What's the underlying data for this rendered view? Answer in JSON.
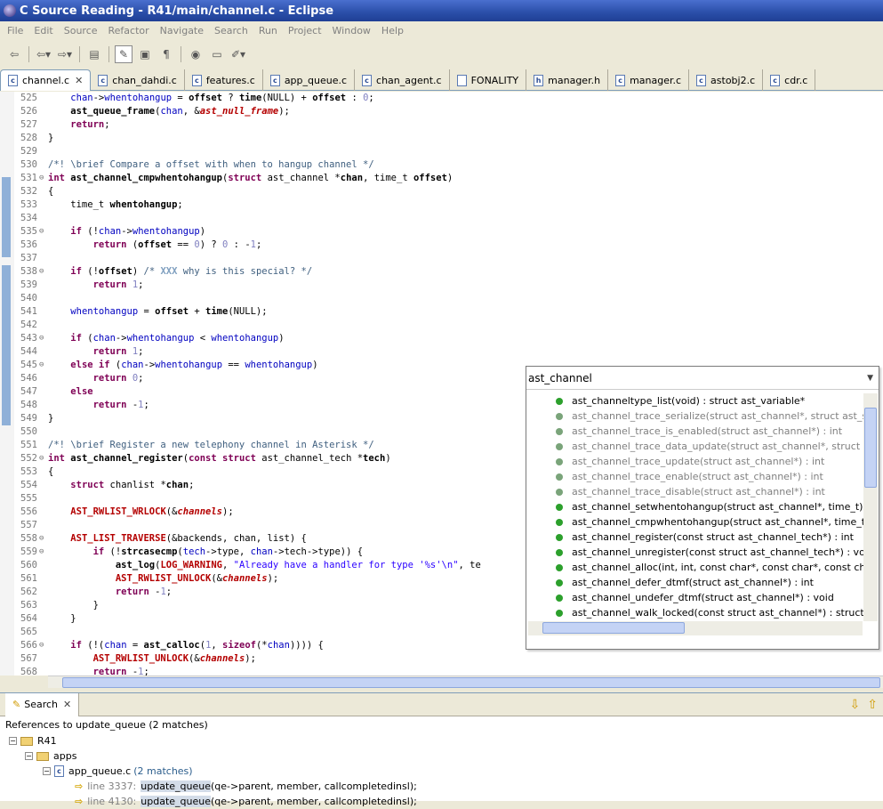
{
  "window": {
    "title": "C Source Reading - R41/main/channel.c - Eclipse"
  },
  "menu": [
    "File",
    "Edit",
    "Source",
    "Refactor",
    "Navigate",
    "Search",
    "Run",
    "Project",
    "Window",
    "Help"
  ],
  "tabs": [
    {
      "label": "channel.c",
      "active": true
    },
    {
      "label": "chan_dahdi.c"
    },
    {
      "label": "features.c"
    },
    {
      "label": "app_queue.c"
    },
    {
      "label": "chan_agent.c"
    },
    {
      "label": "FONALITY"
    },
    {
      "label": "manager.h"
    },
    {
      "label": "manager.c"
    },
    {
      "label": "astobj2.c"
    },
    {
      "label": "cdr.c"
    }
  ],
  "code": [
    {
      "n": "525",
      "f": "",
      "h": "    <span class='fld'>chan</span>-><span class='fld'>whentohangup</span> = <span class='fn'>offset</span> ? <span class='fn'>time</span>(NULL) + <span class='fn'>offset</span> : <span class='num'>0</span>;"
    },
    {
      "n": "526",
      "f": "",
      "h": "    <span class='fn'>ast_queue_frame</span>(<span class='fld'>chan</span>, &amp;<span class='mac'>ast_null_frame</span>);"
    },
    {
      "n": "527",
      "f": "",
      "h": "    <span class='kw'>return</span>;"
    },
    {
      "n": "528",
      "f": "",
      "h": "}"
    },
    {
      "n": "529",
      "f": "",
      "h": ""
    },
    {
      "n": "530",
      "f": "",
      "h": "<span class='cm'>/*! \\brief Compare a offset with when to hangup channel */</span>"
    },
    {
      "n": "531",
      "f": "⊖",
      "h": "<span class='kw'>int</span> <span class='fn'>ast_channel_cmpwhentohangup</span>(<span class='kw'>struct</span> ast_channel *<span class='fn'>chan</span>, time_t <span class='fn'>offset</span>)"
    },
    {
      "n": "532",
      "f": "",
      "h": "{"
    },
    {
      "n": "533",
      "f": "",
      "h": "    time_t <span class='fn'>whentohangup</span>;"
    },
    {
      "n": "534",
      "f": "",
      "h": ""
    },
    {
      "n": "535",
      "f": "⊖",
      "h": "    <span class='kw'>if</span> (!<span class='fld'>chan</span>-><span class='fld'>whentohangup</span>)"
    },
    {
      "n": "536",
      "f": "",
      "h": "        <span class='kw'>return</span> (<span class='fn'>offset</span> == <span class='num'>0</span>) ? <span class='num'>0</span> : -<span class='num'>1</span>;"
    },
    {
      "n": "537",
      "f": "",
      "h": ""
    },
    {
      "n": "538",
      "f": "⊖",
      "h": "    <span class='kw'>if</span> (!<span class='fn'>offset</span>) <span class='cm'>/* <span style='color:#7f9fbf;font-weight:bold'>XXX</span> why is this special? */</span>"
    },
    {
      "n": "539",
      "f": "",
      "h": "        <span class='kw'>return</span> <span class='num'>1</span>;"
    },
    {
      "n": "540",
      "f": "",
      "h": ""
    },
    {
      "n": "541",
      "f": "",
      "h": "    <span class='fld'>whentohangup</span> = <span class='fn'>offset</span> + <span class='fn'>time</span>(NULL);"
    },
    {
      "n": "542",
      "f": "",
      "h": ""
    },
    {
      "n": "543",
      "f": "⊖",
      "h": "    <span class='kw'>if</span> (<span class='fld'>chan</span>-><span class='fld'>whentohangup</span> &lt; <span class='fld'>whentohangup</span>)"
    },
    {
      "n": "544",
      "f": "",
      "h": "        <span class='kw'>return</span> <span class='num'>1</span>;"
    },
    {
      "n": "545",
      "f": "⊖",
      "h": "    <span class='kw'>else if</span> (<span class='fld'>chan</span>-><span class='fld'>whentohangup</span> == <span class='fld'>whentohangup</span>)"
    },
    {
      "n": "546",
      "f": "",
      "h": "        <span class='kw'>return</span> <span class='num'>0</span>;"
    },
    {
      "n": "547",
      "f": "",
      "h": "    <span class='kw'>else</span>"
    },
    {
      "n": "548",
      "f": "",
      "h": "        <span class='kw'>return</span> -<span class='num'>1</span>;"
    },
    {
      "n": "549",
      "f": "",
      "h": "}"
    },
    {
      "n": "550",
      "f": "",
      "h": ""
    },
    {
      "n": "551",
      "f": "",
      "h": "<span class='cm'>/*! \\brief Register a new telephony channel in Asterisk */</span>"
    },
    {
      "n": "552",
      "f": "⊖",
      "h": "<span class='kw'>int</span> <span class='fn'>ast_channel_register</span>(<span class='kw'>const struct</span> ast_channel_tech *<span class='fn'>tech</span>)"
    },
    {
      "n": "553",
      "f": "",
      "h": "{"
    },
    {
      "n": "554",
      "f": "",
      "h": "    <span class='kw'>struct</span> chanlist *<span class='fn'>chan</span>;"
    },
    {
      "n": "555",
      "f": "",
      "h": ""
    },
    {
      "n": "556",
      "f": "",
      "h": "    <span class='mac' style='font-style:normal'>AST_RWLIST_WRLOCK</span>(&amp;<span class='mac'>channels</span>);"
    },
    {
      "n": "557",
      "f": "",
      "h": ""
    },
    {
      "n": "558",
      "f": "⊖",
      "h": "    <span class='mac' style='font-style:normal'>AST_LIST_TRAVERSE</span>(&amp;backends, chan, list) {"
    },
    {
      "n": "559",
      "f": "⊖",
      "h": "        <span class='kw'>if</span> (!<span class='fn'>strcasecmp</span>(<span class='fld'>tech</span>->type, <span class='fld'>chan</span>->tech->type)) {"
    },
    {
      "n": "560",
      "f": "",
      "h": "            <span class='fn'>ast_log</span>(<span class='mac' style='font-style:normal'>LOG_WARNING</span>, <span class='str'>\"Already have a handler for type '%s'\\n\"</span>, te"
    },
    {
      "n": "561",
      "f": "",
      "h": "            <span class='mac' style='font-style:normal'>AST_RWLIST_UNLOCK</span>(&amp;<span class='mac'>channels</span>);"
    },
    {
      "n": "562",
      "f": "",
      "h": "            <span class='kw'>return</span> -<span class='num'>1</span>;"
    },
    {
      "n": "563",
      "f": "",
      "h": "        }"
    },
    {
      "n": "564",
      "f": "",
      "h": "    }"
    },
    {
      "n": "565",
      "f": "",
      "h": ""
    },
    {
      "n": "566",
      "f": "⊖",
      "h": "    <span class='kw'>if</span> (!(<span class='fld'>chan</span> = <span class='fn'>ast_calloc</span>(<span class='num'>1</span>, <span class='kw'>sizeof</span>(*<span class='fld'>chan</span>)))) {"
    },
    {
      "n": "567",
      "f": "",
      "h": "        <span class='mac' style='font-style:normal'>AST_RWLIST_UNLOCK</span>(&amp;<span class='mac'>channels</span>);"
    },
    {
      "n": "568",
      "f": "",
      "h": "        <span class='kw'>return</span> -<span class='num'>1</span>;"
    }
  ],
  "popup": {
    "query": "ast_channel",
    "items": [
      {
        "text": "ast_channeltype_list(void) : struct ast_variable*",
        "grey": false
      },
      {
        "text": "ast_channel_trace_serialize(struct ast_channel*, struct ast_str**)",
        "grey": true
      },
      {
        "text": "ast_channel_trace_is_enabled(struct ast_channel*) : int",
        "grey": true
      },
      {
        "text": "ast_channel_trace_data_update(struct ast_channel*, struct ast_ch",
        "grey": true
      },
      {
        "text": "ast_channel_trace_update(struct ast_channel*) : int",
        "grey": true
      },
      {
        "text": "ast_channel_trace_enable(struct ast_channel*) : int",
        "grey": true
      },
      {
        "text": "ast_channel_trace_disable(struct ast_channel*) : int",
        "grey": true
      },
      {
        "text": "ast_channel_setwhentohangup(struct ast_channel*, time_t) : void",
        "grey": false
      },
      {
        "text": "ast_channel_cmpwhentohangup(struct ast_channel*, time_t) : int",
        "grey": false
      },
      {
        "text": "ast_channel_register(const struct ast_channel_tech*) : int",
        "grey": false
      },
      {
        "text": "ast_channel_unregister(const struct ast_channel_tech*) : void",
        "grey": false
      },
      {
        "text": "ast_channel_alloc(int, int, const char*, const char*, const char*, c",
        "grey": false
      },
      {
        "text": "ast_channel_defer_dtmf(struct ast_channel*) : int",
        "grey": false
      },
      {
        "text": "ast_channel_undefer_dtmf(struct ast_channel*) : void",
        "grey": false
      },
      {
        "text": "ast_channel_walk_locked(const struct ast_channel*) : struct ast_ch",
        "grey": false
      }
    ]
  },
  "search": {
    "tab_label": "Search",
    "summary": "References to update_queue (2 matches)",
    "project": "R41",
    "folder": "apps",
    "file": "app_queue.c",
    "file_count": "(2 matches)",
    "lines": [
      {
        "line": "line 3337:",
        "match": "update_queue",
        "rest": "(qe->parent, member, callcompletedinsl);"
      },
      {
        "line": "line 4130:",
        "match": "update_queue",
        "rest": "(qe->parent, member, callcompletedinsl);"
      }
    ]
  }
}
